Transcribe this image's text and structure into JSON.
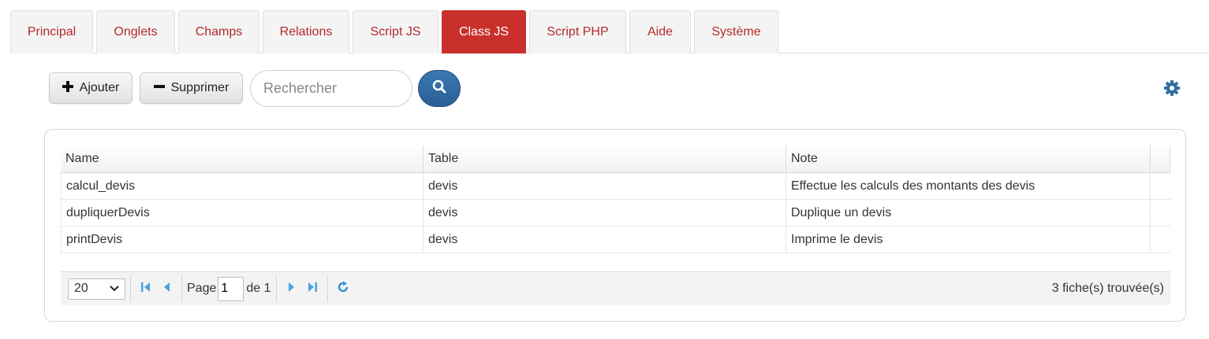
{
  "tabs": [
    {
      "label": "Principal",
      "active": false
    },
    {
      "label": "Onglets",
      "active": false
    },
    {
      "label": "Champs",
      "active": false
    },
    {
      "label": "Relations",
      "active": false
    },
    {
      "label": "Script JS",
      "active": false
    },
    {
      "label": "Class JS",
      "active": true
    },
    {
      "label": "Script PHP",
      "active": false
    },
    {
      "label": "Aide",
      "active": false
    },
    {
      "label": "Système",
      "active": false
    }
  ],
  "toolbar": {
    "add_label": "Ajouter",
    "delete_label": "Supprimer",
    "search_placeholder": "Rechercher",
    "search_value": ""
  },
  "grid": {
    "columns": [
      "Name",
      "Table",
      "Note"
    ],
    "rows": [
      [
        "calcul_devis",
        "devis",
        "Effectue les calculs des montants des devis"
      ],
      [
        "dupliquerDevis",
        "devis",
        "Duplique un devis"
      ],
      [
        "printDevis",
        "devis",
        "Imprime le devis"
      ]
    ]
  },
  "pager": {
    "page_size": "20",
    "page_label": "Page",
    "current_page": "1",
    "of_label": "de 1",
    "found_text": "3 fiche(s) trouvée(s)"
  },
  "colors": {
    "tab_active": "#c9302c",
    "tab_text": "#b52a2a",
    "primary_blue": "#2a5f95",
    "pager_icon": "#4aa3df"
  },
  "icons": {
    "add": "plus-icon",
    "delete": "minus-icon",
    "search": "search-icon",
    "settings": "gear-icon",
    "first": "first-page-icon",
    "prev": "prev-page-icon",
    "next": "next-page-icon",
    "last": "last-page-icon",
    "refresh": "refresh-icon"
  }
}
